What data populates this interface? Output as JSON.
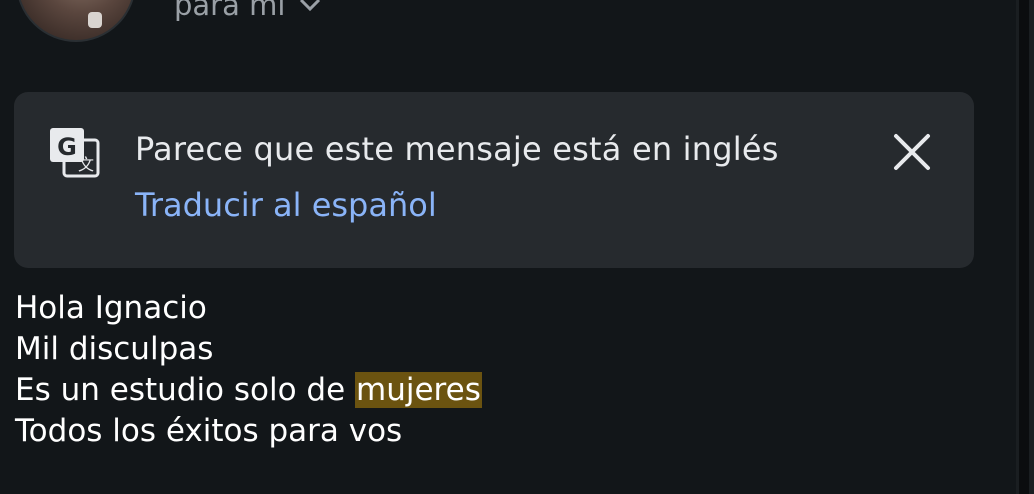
{
  "header": {
    "recipient_label": "para mí"
  },
  "translate_banner": {
    "message": "Parece que este mensaje está en inglés",
    "action": "Traducir al español",
    "link_color": "#8ab4f8"
  },
  "email_body": {
    "lines": [
      "Hola Ignacio",
      "Mil disculpas"
    ],
    "line3_prefix": "Es un estudio solo de ",
    "line3_highlight": "mujeres",
    "line4": "Todos los éxitos para vos",
    "highlight_color": "#6b5310"
  },
  "icons": [
    "translate-icon",
    "close-icon",
    "chevron-down-icon"
  ]
}
